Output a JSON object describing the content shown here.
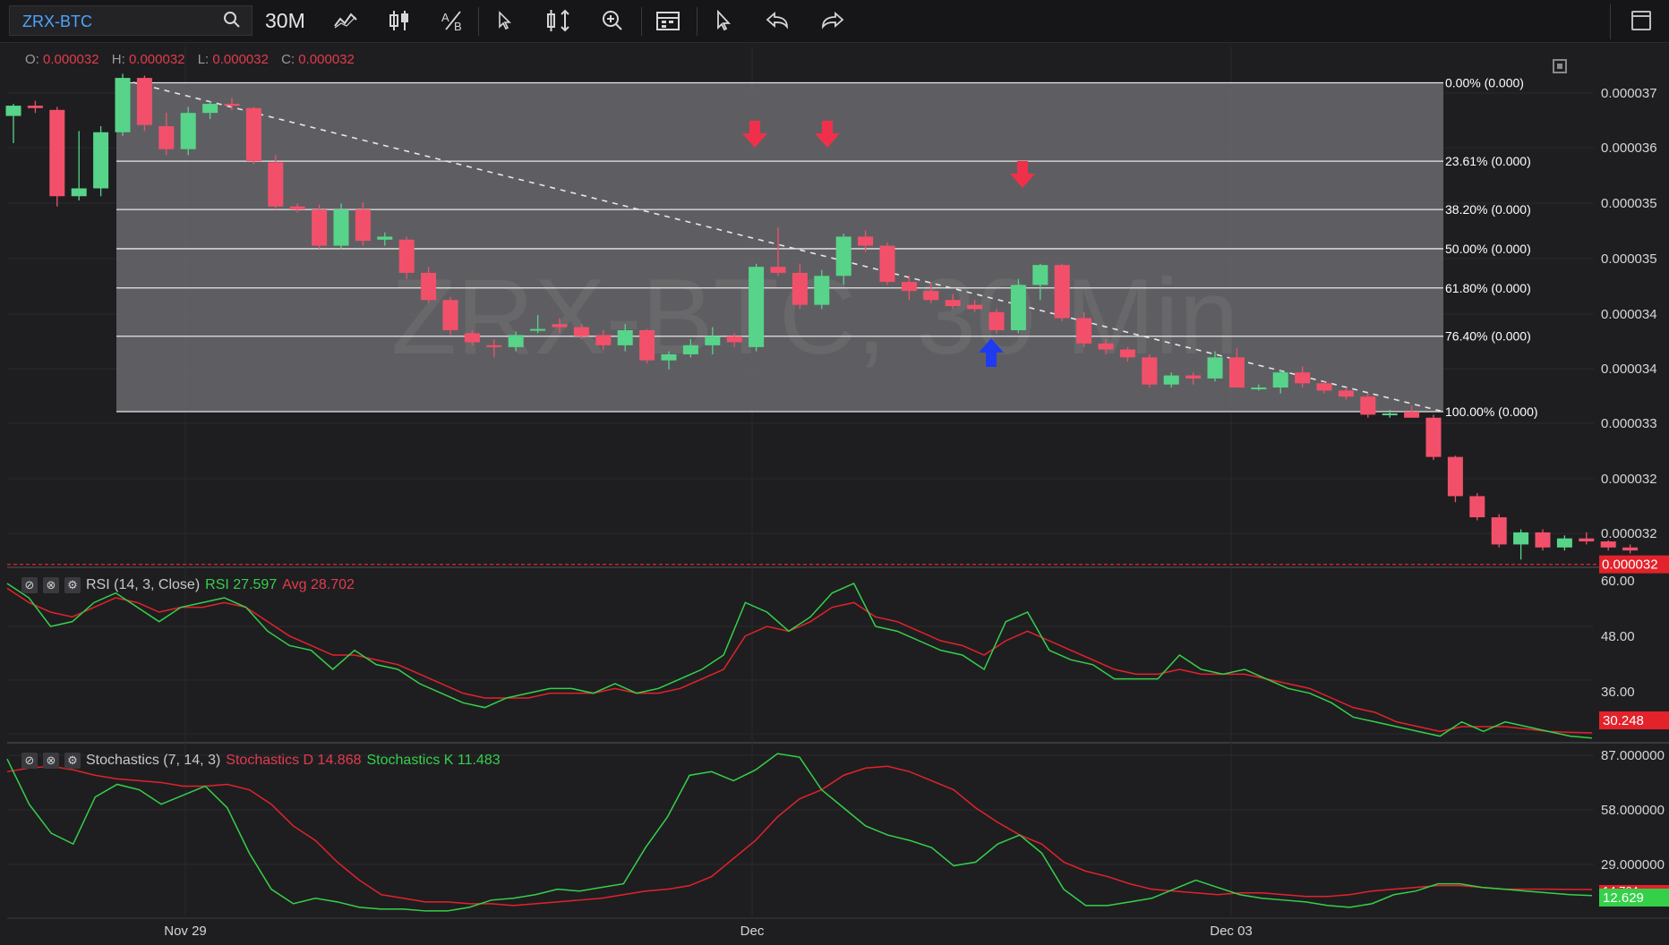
{
  "toolbar": {
    "symbol": "ZRX-BTC",
    "interval": "30M",
    "icons": [
      "search-icon",
      "indicators-icon",
      "chart-type-icon",
      "compare-icon",
      "crosshair-icon",
      "scale-icon",
      "zoom-icon",
      "datetime-icon",
      "draw-cursor-icon",
      "undo-icon",
      "redo-icon",
      "layout-icon"
    ]
  },
  "legend": {
    "o_label": "O:",
    "o_value": "0.000032",
    "h_label": "H:",
    "h_value": "0.000032",
    "l_label": "L:",
    "l_value": "0.000032",
    "c_label": "C:",
    "c_value": "0.000032"
  },
  "watermark": "ZRX-BTC, 30 Min",
  "rsi_legend": {
    "name": "RSI (14, 3, Close)",
    "rsi_label": "RSI 27.597",
    "avg_label": "Avg 28.702"
  },
  "stoch_legend": {
    "name": "Stochastics (7, 14, 3)",
    "d_label": "Stochastics D 14.868",
    "k_label": "Stochastics K 11.483"
  },
  "colors": {
    "up": "#57d48a",
    "down": "#f2506a",
    "rsi": "#35d04a",
    "avg": "#e3222b",
    "fib_fill": "#6a6a6e",
    "arrow_down": "#f0304a",
    "arrow_up": "#1f3bf0"
  },
  "chart_data": [
    {
      "type": "candlestick",
      "title": "ZRX-BTC, 30 Min",
      "x_ticks": [
        "Nov 29",
        "Dec",
        "Dec 03"
      ],
      "y_ticks": [
        "0.000037",
        "0.000036",
        "0.000035",
        "0.000035",
        "0.000034",
        "0.000034",
        "0.000033",
        "0.000032",
        "0.000032"
      ],
      "last_price": "0.000032",
      "candles": [
        [
          3.745e-05,
          3.765e-05,
          3.7e-05,
          3.762e-05
        ],
        [
          3.762e-05,
          3.77e-05,
          3.75e-05,
          3.758e-05
        ],
        [
          3.755e-05,
          3.76e-05,
          3.595e-05,
          3.612e-05
        ],
        [
          3.612e-05,
          3.72e-05,
          3.605e-05,
          3.625e-05
        ],
        [
          3.625e-05,
          3.728e-05,
          3.612e-05,
          3.718e-05
        ],
        [
          3.718e-05,
          3.815e-05,
          3.712e-05,
          3.808e-05
        ],
        [
          3.808e-05,
          3.812e-05,
          3.72e-05,
          3.73e-05
        ],
        [
          3.728e-05,
          3.75e-05,
          3.68e-05,
          3.69e-05
        ],
        [
          3.69e-05,
          3.76e-05,
          3.68e-05,
          3.75e-05
        ],
        [
          3.75e-05,
          3.77e-05,
          3.74e-05,
          3.765e-05
        ],
        [
          3.765e-05,
          3.775e-05,
          3.755e-05,
          3.762e-05
        ],
        [
          3.758e-05,
          3.76e-05,
          3.665e-05,
          3.67e-05
        ],
        [
          3.668e-05,
          3.68e-05,
          3.59e-05,
          3.595e-05
        ],
        [
          3.595e-05,
          3.6e-05,
          3.585e-05,
          3.59e-05
        ],
        [
          3.59e-05,
          3.598e-05,
          3.525e-05,
          3.53e-05
        ],
        [
          3.53e-05,
          3.6e-05,
          3.525e-05,
          3.59e-05
        ],
        [
          3.59e-05,
          3.602e-05,
          3.53e-05,
          3.538e-05
        ],
        [
          3.54e-05,
          3.552e-05,
          3.53e-05,
          3.545e-05
        ],
        [
          3.54e-05,
          3.545e-05,
          3.475e-05,
          3.485e-05
        ],
        [
          3.485e-05,
          3.495e-05,
          3.435e-05,
          3.44e-05
        ],
        [
          3.44e-05,
          3.445e-05,
          3.382e-05,
          3.39e-05
        ],
        [
          3.385e-05,
          3.39e-05,
          3.365e-05,
          3.37e-05
        ],
        [
          3.365e-05,
          3.375e-05,
          3.345e-05,
          3.362e-05
        ],
        [
          3.362e-05,
          3.388e-05,
          3.355e-05,
          3.382e-05
        ],
        [
          3.39e-05,
          3.415e-05,
          3.385e-05,
          3.392e-05
        ],
        [
          3.4e-05,
          3.41e-05,
          3.385e-05,
          3.395e-05
        ],
        [
          3.395e-05,
          3.4e-05,
          3.375e-05,
          3.38e-05
        ],
        [
          3.382e-05,
          3.39e-05,
          3.357e-05,
          3.365e-05
        ],
        [
          3.365e-05,
          3.4e-05,
          3.355e-05,
          3.39e-05
        ],
        [
          3.39e-05,
          3.392e-05,
          3.335e-05,
          3.34e-05
        ],
        [
          3.34e-05,
          3.355e-05,
          3.325e-05,
          3.35e-05
        ],
        [
          3.35e-05,
          3.375e-05,
          3.345e-05,
          3.365e-05
        ],
        [
          3.365e-05,
          3.395e-05,
          3.35e-05,
          3.38e-05
        ],
        [
          3.38e-05,
          3.385e-05,
          3.362e-05,
          3.37e-05
        ],
        [
          3.362e-05,
          3.5e-05,
          3.355e-05,
          3.495e-05
        ],
        [
          3.495e-05,
          3.56e-05,
          3.48e-05,
          3.485e-05
        ],
        [
          3.485e-05,
          3.5e-05,
          3.425e-05,
          3.432e-05
        ],
        [
          3.432e-05,
          3.49e-05,
          3.425e-05,
          3.48e-05
        ],
        [
          3.48e-05,
          3.55e-05,
          3.465e-05,
          3.545e-05
        ],
        [
          3.545e-05,
          3.555e-05,
          3.52e-05,
          3.53e-05
        ],
        [
          3.53e-05,
          3.535e-05,
          3.465e-05,
          3.47e-05
        ],
        [
          3.47e-05,
          3.48e-05,
          3.44e-05,
          3.455e-05
        ],
        [
          3.455e-05,
          3.47e-05,
          3.435e-05,
          3.44e-05
        ],
        [
          3.44e-05,
          3.45e-05,
          3.425e-05,
          3.43e-05
        ],
        [
          3.432e-05,
          3.44e-05,
          3.42e-05,
          3.425e-05
        ],
        [
          3.42e-05,
          3.425e-05,
          3.385e-05,
          3.39e-05
        ],
        [
          3.39e-05,
          3.475e-05,
          3.385e-05,
          3.465e-05
        ],
        [
          3.465e-05,
          3.5e-05,
          3.44e-05,
          3.498e-05
        ],
        [
          3.498e-05,
          3.5e-05,
          3.405e-05,
          3.41e-05
        ],
        [
          3.41e-05,
          3.42e-05,
          3.362e-05,
          3.368e-05
        ],
        [
          3.368e-05,
          3.375e-05,
          3.35e-05,
          3.358e-05
        ],
        [
          3.358e-05,
          3.362e-05,
          3.338e-05,
          3.345e-05
        ],
        [
          3.345e-05,
          3.35e-05,
          3.295e-05,
          3.3e-05
        ],
        [
          3.3e-05,
          3.32e-05,
          3.295e-05,
          3.315e-05
        ],
        [
          3.315e-05,
          3.32e-05,
          3.3e-05,
          3.31e-05
        ],
        [
          3.31e-05,
          3.355e-05,
          3.305e-05,
          3.345e-05
        ],
        [
          3.345e-05,
          3.36e-05,
          3.295e-05,
          3.295e-05
        ],
        [
          3.295e-05,
          3.3e-05,
          3.29e-05,
          3.295e-05
        ],
        [
          3.295e-05,
          3.325e-05,
          3.285e-05,
          3.32e-05
        ],
        [
          3.32e-05,
          3.33e-05,
          3.295e-05,
          3.302e-05
        ],
        [
          3.302e-05,
          3.305e-05,
          3.285e-05,
          3.29e-05
        ],
        [
          3.29e-05,
          3.295e-05,
          3.275e-05,
          3.28e-05
        ],
        [
          3.28e-05,
          3.285e-05,
          3.245e-05,
          3.25e-05
        ],
        [
          3.25e-05,
          3.258e-05,
          3.245e-05,
          3.252e-05
        ],
        [
          3.255e-05,
          3.265e-05,
          3.245e-05,
          3.245e-05
        ],
        [
          3.245e-05,
          3.25e-05,
          3.175e-05,
          3.18e-05
        ],
        [
          3.18e-05,
          3.182e-05,
          3.105e-05,
          3.115e-05
        ],
        [
          3.115e-05,
          3.12e-05,
          3.075e-05,
          3.08e-05
        ],
        [
          3.08e-05,
          3.085e-05,
          3.03e-05,
          3.035e-05
        ],
        [
          3.035e-05,
          3.06e-05,
          3.01e-05,
          3.055e-05
        ],
        [
          3.055e-05,
          3.06e-05,
          3.025e-05,
          3.03e-05
        ],
        [
          3.03e-05,
          3.05e-05,
          3.025e-05,
          3.045e-05
        ],
        [
          3.045e-05,
          3.055e-05,
          3.035e-05,
          3.04e-05
        ],
        [
          3.04e-05,
          3.042e-05,
          3.025e-05,
          3.03e-05
        ],
        [
          3.03e-05,
          3.035e-05,
          3.02e-05,
          3.025e-05
        ]
      ],
      "fib_levels": [
        {
          "label": "0.00% (0.000)",
          "price": 3.8e-05
        },
        {
          "label": "23.61% (0.000)",
          "price": 3.67e-05
        },
        {
          "label": "38.20% (0.000)",
          "price": 3.59e-05
        },
        {
          "label": "50.00% (0.000)",
          "price": 3.525e-05
        },
        {
          "label": "61.80% (0.000)",
          "price": 3.46e-05
        },
        {
          "label": "76.40% (0.000)",
          "price": 3.38e-05
        },
        {
          "label": "100.00% (0.000)",
          "price": 3.255e-05
        }
      ]
    },
    {
      "type": "line",
      "title": "RSI (14, 3, Close)",
      "y_ticks": [
        "60.00",
        "48.00",
        "36.00"
      ],
      "last_value_label": "30.248",
      "series": [
        {
          "name": "RSI",
          "values": [
            60,
            57,
            51,
            52,
            56,
            58,
            55,
            52,
            55,
            56,
            57,
            55,
            50,
            47,
            46,
            42,
            46,
            43,
            42,
            39,
            37,
            35,
            34,
            36,
            37,
            38,
            38,
            37,
            39,
            37,
            38,
            40,
            42,
            45,
            56,
            54,
            50,
            53,
            58,
            60,
            51,
            50,
            48,
            46,
            45,
            42,
            52,
            54,
            46,
            44,
            43,
            40,
            40,
            40,
            45,
            42,
            41,
            42,
            40,
            38,
            37,
            35,
            32,
            31,
            30,
            29,
            28,
            31,
            29,
            31,
            30,
            29,
            28,
            27.6
          ]
        },
        {
          "name": "Avg",
          "values": [
            59,
            56,
            54,
            53,
            55,
            57,
            56,
            54,
            55,
            55,
            56,
            55,
            52,
            49,
            47,
            45,
            45,
            44,
            43,
            41,
            39,
            37,
            36,
            36,
            36,
            37,
            37,
            37,
            38,
            37,
            37,
            38,
            40,
            42,
            49,
            51,
            50,
            52,
            55,
            56,
            53,
            52,
            50,
            48,
            47,
            45,
            48,
            50,
            48,
            46,
            44,
            42,
            41,
            41,
            42,
            41,
            41,
            41,
            40,
            39,
            38,
            36,
            34,
            33,
            31,
            30,
            29,
            30,
            30,
            30,
            29.5,
            29,
            28.8,
            28.7
          ]
        }
      ]
    },
    {
      "type": "line",
      "title": "Stochastics (7, 14, 3)",
      "y_ticks": [
        "87.000000",
        "58.000000",
        "29.000000"
      ],
      "last_value_labels": [
        "14.764",
        "12.629"
      ],
      "series": [
        {
          "name": "Stochastics D",
          "values": [
            80,
            82,
            83,
            81,
            78,
            76,
            75,
            74,
            72,
            72,
            73,
            70,
            62,
            50,
            42,
            30,
            20,
            12,
            10,
            8,
            8,
            7,
            7,
            6,
            7,
            8,
            9,
            10,
            12,
            14,
            15,
            17,
            22,
            32,
            42,
            55,
            65,
            70,
            78,
            82,
            83,
            80,
            75,
            70,
            60,
            52,
            45,
            40,
            30,
            25,
            22,
            18,
            15,
            14,
            13,
            12,
            13,
            13,
            12,
            11,
            11,
            12,
            14,
            15,
            16,
            17,
            17,
            16,
            15,
            15,
            15,
            14.9,
            14.868
          ]
        },
        {
          "name": "Stochastics K",
          "values": [
            87,
            62,
            46,
            40,
            66,
            73,
            70,
            62,
            67,
            72,
            60,
            35,
            15,
            7,
            10,
            8,
            5,
            4,
            4,
            3,
            3,
            5,
            9,
            10,
            12,
            15,
            14,
            16,
            18,
            38,
            55,
            78,
            80,
            75,
            81,
            90,
            88,
            70,
            60,
            50,
            45,
            42,
            38,
            28,
            30,
            40,
            45,
            35,
            15,
            6,
            6,
            8,
            10,
            15,
            20,
            16,
            12,
            10,
            9,
            8,
            6,
            5,
            7,
            12,
            14,
            18,
            18,
            16,
            15,
            14,
            13,
            12,
            11.483
          ]
        }
      ]
    }
  ]
}
